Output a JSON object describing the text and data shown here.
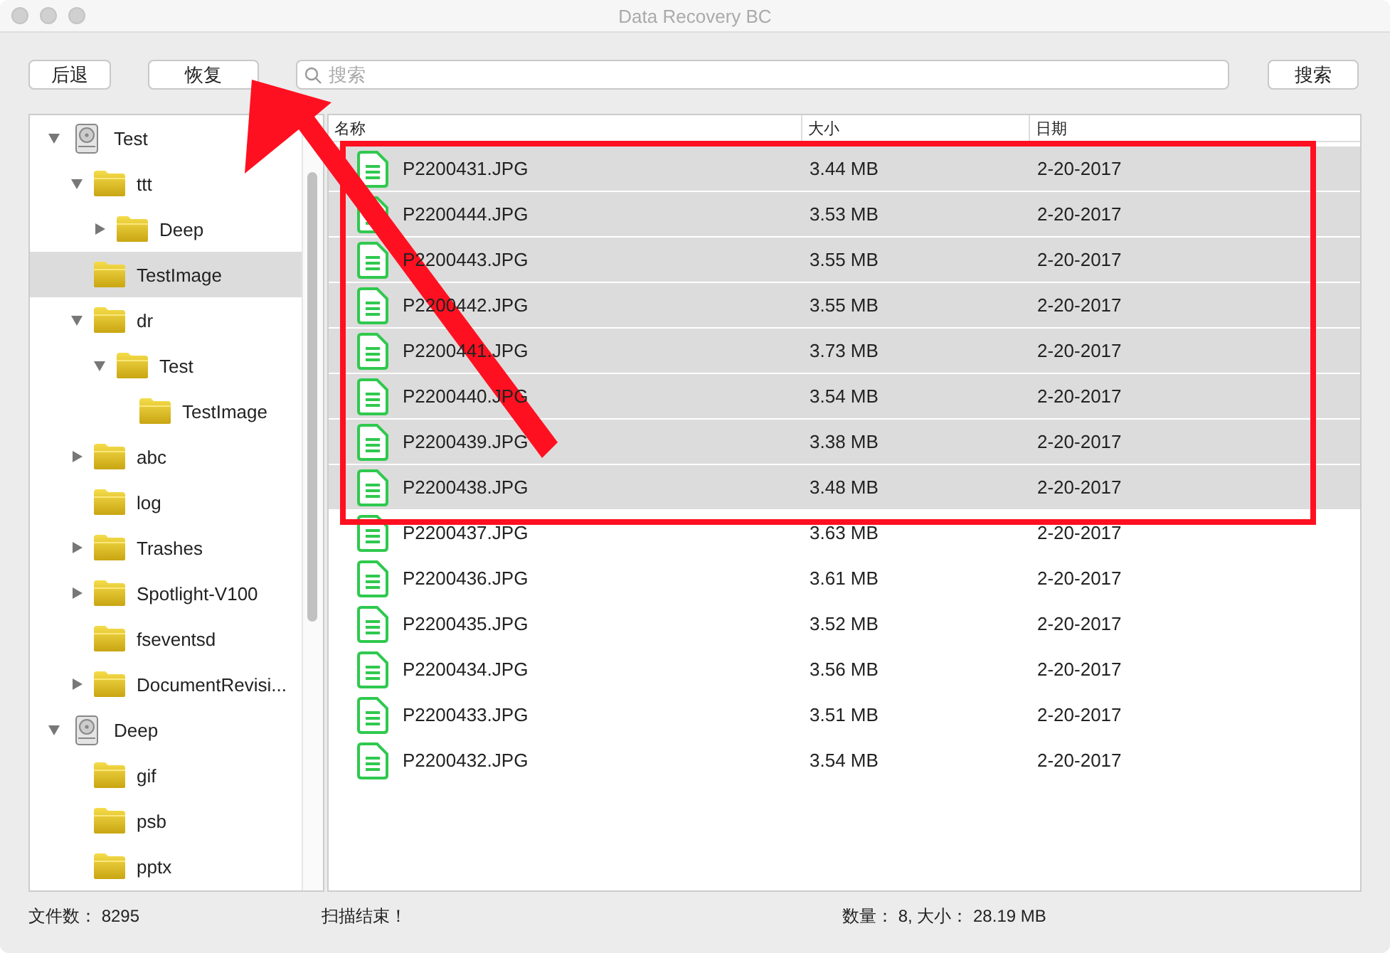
{
  "window": {
    "title": "Data Recovery BC"
  },
  "toolbar": {
    "back_button": "后退",
    "recover_button": "恢复",
    "search": {
      "placeholder": "搜索"
    },
    "search_button": "搜索"
  },
  "tree": {
    "items": [
      {
        "kind": "drive",
        "label": "Test",
        "expanded": true,
        "selected": false,
        "children": [
          {
            "kind": "folder",
            "label": "ttt",
            "expanded": true,
            "selected": false,
            "children": [
              {
                "kind": "folder",
                "label": "Deep",
                "expanded": false,
                "selected": false
              }
            ]
          },
          {
            "kind": "folder",
            "label": "TestImage",
            "selected": true
          },
          {
            "kind": "folder",
            "label": "dr",
            "expanded": true,
            "selected": false,
            "children": [
              {
                "kind": "folder",
                "label": "Test",
                "expanded": true,
                "selected": false,
                "children": [
                  {
                    "kind": "folder",
                    "label": "TestImage",
                    "selected": false
                  }
                ]
              }
            ]
          },
          {
            "kind": "folder",
            "label": "abc",
            "expanded": false,
            "selected": false
          },
          {
            "kind": "folder",
            "label": "log",
            "selected": false
          },
          {
            "kind": "folder",
            "label": "Trashes",
            "expanded": false,
            "selected": false
          },
          {
            "kind": "folder",
            "label": "Spotlight-V100",
            "expanded": false,
            "selected": false
          },
          {
            "kind": "folder",
            "label": "fseventsd",
            "selected": false
          },
          {
            "kind": "folder",
            "label": "DocumentRevisi...",
            "expanded": false,
            "selected": false
          }
        ]
      },
      {
        "kind": "drive",
        "label": "Deep",
        "expanded": true,
        "selected": false,
        "children": [
          {
            "kind": "folder",
            "label": "gif",
            "selected": false
          },
          {
            "kind": "folder",
            "label": "psb",
            "selected": false
          },
          {
            "kind": "folder",
            "label": "pptx",
            "selected": false
          }
        ]
      }
    ]
  },
  "table": {
    "columns": [
      "名称",
      "大小",
      "日期"
    ],
    "rows": [
      {
        "name": "P2200431.JPG",
        "size": "3.44 MB",
        "date": "2-20-2017",
        "selected": true
      },
      {
        "name": "P2200444.JPG",
        "size": "3.53 MB",
        "date": "2-20-2017",
        "selected": true
      },
      {
        "name": "P2200443.JPG",
        "size": "3.55 MB",
        "date": "2-20-2017",
        "selected": true
      },
      {
        "name": "P2200442.JPG",
        "size": "3.55 MB",
        "date": "2-20-2017",
        "selected": true
      },
      {
        "name": "P2200441.JPG",
        "size": "3.73 MB",
        "date": "2-20-2017",
        "selected": true
      },
      {
        "name": "P2200440.JPG",
        "size": "3.54 MB",
        "date": "2-20-2017",
        "selected": true
      },
      {
        "name": "P2200439.JPG",
        "size": "3.38 MB",
        "date": "2-20-2017",
        "selected": true
      },
      {
        "name": "P2200438.JPG",
        "size": "3.48 MB",
        "date": "2-20-2017",
        "selected": true
      },
      {
        "name": "P2200437.JPG",
        "size": "3.63 MB",
        "date": "2-20-2017",
        "selected": false
      },
      {
        "name": "P2200436.JPG",
        "size": "3.61 MB",
        "date": "2-20-2017",
        "selected": false
      },
      {
        "name": "P2200435.JPG",
        "size": "3.52 MB",
        "date": "2-20-2017",
        "selected": false
      },
      {
        "name": "P2200434.JPG",
        "size": "3.56 MB",
        "date": "2-20-2017",
        "selected": false
      },
      {
        "name": "P2200433.JPG",
        "size": "3.51 MB",
        "date": "2-20-2017",
        "selected": false
      },
      {
        "name": "P2200432.JPG",
        "size": "3.54 MB",
        "date": "2-20-2017",
        "selected": false
      }
    ]
  },
  "status_bar": {
    "file_count": "文件数：  8295",
    "message": "扫描结束！",
    "selection": "数量：  8,  大小：  28.19 MB"
  }
}
